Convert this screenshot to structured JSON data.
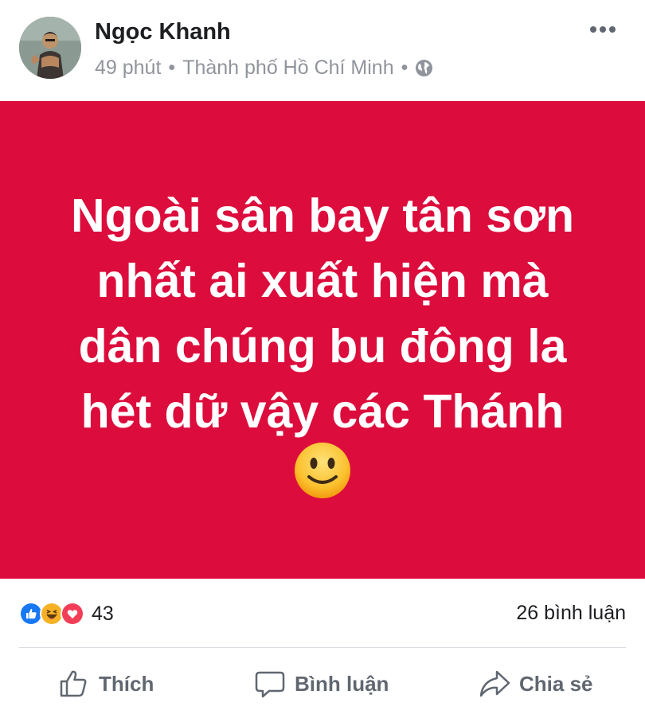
{
  "post": {
    "author": "Ngọc Khanh",
    "time": "49 phút",
    "separator": "•",
    "location": "Thành phố Hồ Chí Minh",
    "privacy_icon": "globe-icon",
    "more_icon": "more-options-icon"
  },
  "banner": {
    "background_color": "#dc0c3c",
    "lines": [
      "Ngoài sân bay tân sơn",
      "nhất ai xuất hiện mà",
      "dân chúng bu đông la",
      "hét dữ vậy các Thánh"
    ],
    "emoji": "slightly-smiling-face-emoji"
  },
  "reactions": {
    "icons": [
      "like-reaction-icon",
      "haha-reaction-icon",
      "love-reaction-icon"
    ],
    "count": "43"
  },
  "comments_count": "26 bình luận",
  "actions": {
    "like": "Thích",
    "comment": "Bình luận",
    "share": "Chia sẻ"
  },
  "colors": {
    "brand_blue": "#1877f2",
    "love_red": "#f33e58",
    "secondary_text": "#90949c",
    "action_text": "#606770"
  }
}
